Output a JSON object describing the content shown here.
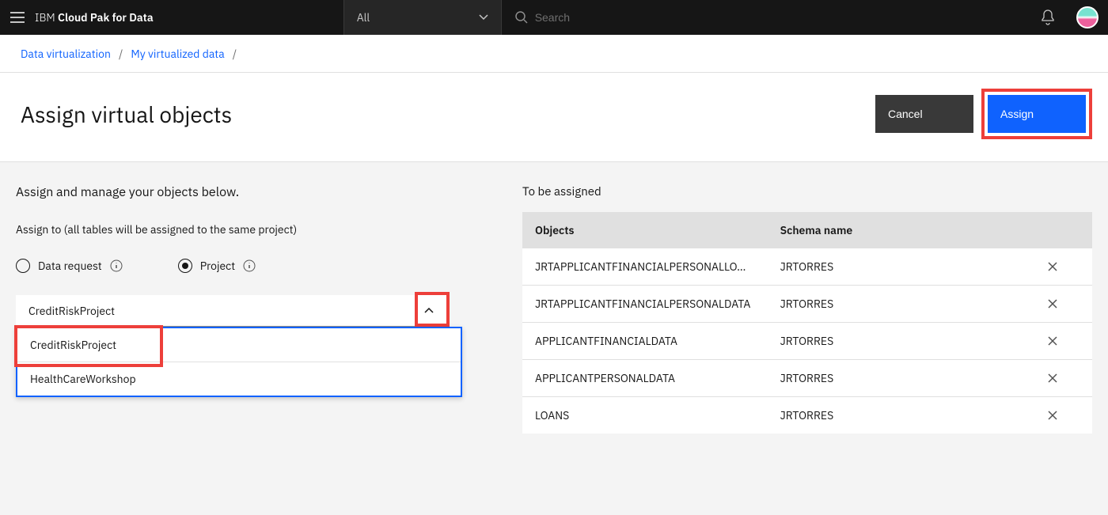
{
  "header": {
    "brand_prefix": "IBM ",
    "brand_bold": "Cloud Pak for Data",
    "scope_label": "All",
    "search_placeholder": "Search"
  },
  "breadcrumb": {
    "items": [
      {
        "label": "Data virtualization"
      },
      {
        "label": "My virtualized data"
      }
    ]
  },
  "page": {
    "title": "Assign virtual objects",
    "cancel_label": "Cancel",
    "assign_label": "Assign"
  },
  "left": {
    "instruction": "Assign and manage your objects below.",
    "assign_to_label": "Assign to (all tables will be assigned to the same project)",
    "radio_data_request": "Data request",
    "radio_project": "Project",
    "dropdown_selected": "CreditRiskProject",
    "dropdown_options": [
      "CreditRiskProject",
      "HealthCareWorkshop"
    ]
  },
  "right": {
    "title": "To be assigned",
    "col_objects": "Objects",
    "col_schema": "Schema name",
    "rows": [
      {
        "object": "JRTAPPLICANTFINANCIALPERSONALLO…",
        "schema": "JRTORRES"
      },
      {
        "object": "JRTAPPLICANTFINANCIALPERSONALDATA",
        "schema": "JRTORRES"
      },
      {
        "object": "APPLICANTFINANCIALDATA",
        "schema": "JRTORRES"
      },
      {
        "object": "APPLICANTPERSONALDATA",
        "schema": "JRTORRES"
      },
      {
        "object": "LOANS",
        "schema": "JRTORRES"
      }
    ]
  }
}
